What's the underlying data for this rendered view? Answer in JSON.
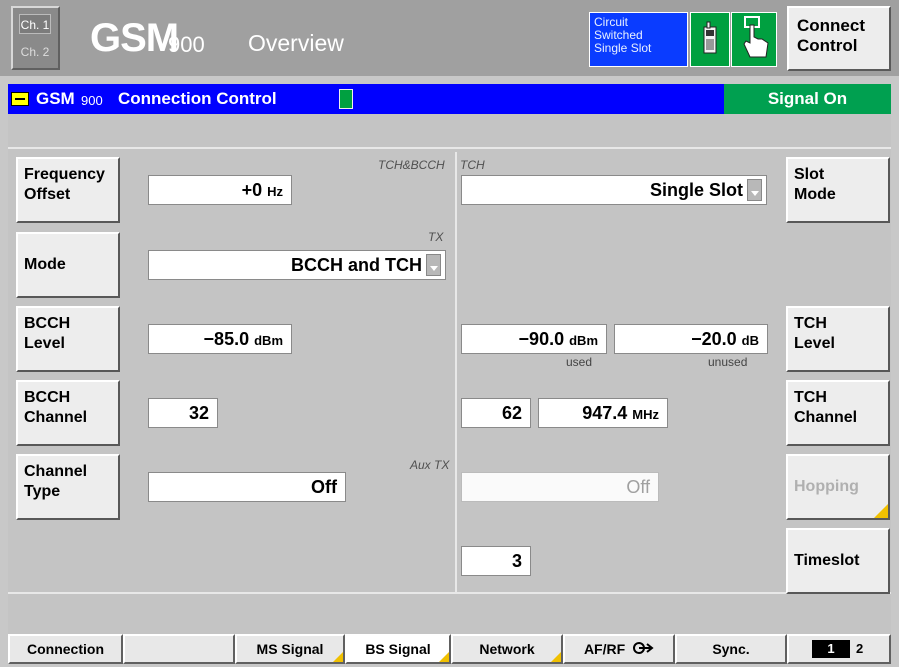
{
  "title_bar": {
    "channel_1": "Ch. 1",
    "channel_2": "Ch. 2",
    "product": "GSM",
    "band": "900",
    "screen": "Overview",
    "status_line1": "Circuit",
    "status_line2": "Switched",
    "status_line3": "Single Slot",
    "connect_control_line1": "Connect",
    "connect_control_line2": "Control"
  },
  "header": {
    "product": "GSM",
    "band": "900",
    "title": "Connection Control",
    "signal_status": "Signal On"
  },
  "labels": {
    "tch_bcch": "TCH&BCCH",
    "tch": "TCH",
    "tx": "TX",
    "aux_tx": "Aux TX",
    "used": "used",
    "unused": "unused"
  },
  "left_buttons": {
    "frequency_offset_1": "Frequency",
    "frequency_offset_2": "Offset",
    "mode": "Mode",
    "bcch_level_1": "BCCH",
    "bcch_level_2": "Level",
    "bcch_channel_1": "BCCH",
    "bcch_channel_2": "Channel",
    "channel_type_1": "Channel",
    "channel_type_2": "Type"
  },
  "right_buttons": {
    "slot_mode_1": "Slot",
    "slot_mode_2": "Mode",
    "tch_level_1": "TCH",
    "tch_level_2": "Level",
    "tch_channel_1": "TCH",
    "tch_channel_2": "Channel",
    "hopping": "Hopping",
    "timeslot": "Timeslot"
  },
  "fields": {
    "frequency_offset_value": "+0",
    "frequency_offset_unit": "Hz",
    "slot_mode_value": "Single Slot",
    "mode_value": "BCCH and TCH",
    "bcch_level_value": "−85.0",
    "bcch_level_unit": "dBm",
    "tch_level_used_value": "−90.0",
    "tch_level_used_unit": "dBm",
    "tch_level_unused_value": "−20.0",
    "tch_level_unused_unit": "dB",
    "bcch_channel_value": "32",
    "tch_channel_value": "62",
    "tch_frequency_value": "947.4",
    "tch_frequency_unit": "MHz",
    "channel_type_value": "Off",
    "aux_tx_value": "Off",
    "timeslot_value": "3"
  },
  "tabs": {
    "connection": "Connection",
    "blank": "",
    "ms_signal": "MS Signal",
    "bs_signal": "BS Signal",
    "network": "Network",
    "af_rf": "AF/RF",
    "sync": "Sync.",
    "page_1": "1",
    "page_2": "2"
  },
  "colors": {
    "header_blue": "#0000ff",
    "signal_on_green": "#00a050",
    "status_blue": "#0a3cff",
    "softkey_corner": "#f0c000"
  }
}
